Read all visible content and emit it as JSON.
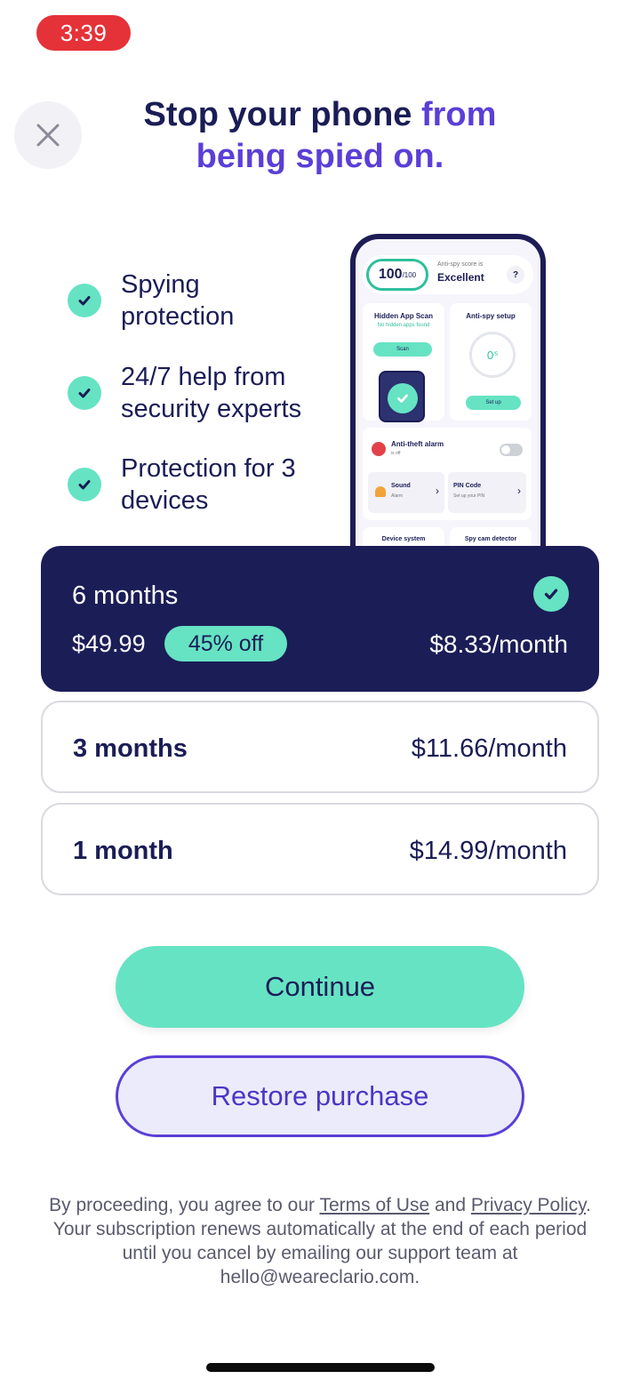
{
  "status_bar": {
    "time": "3:39"
  },
  "header": {
    "close_icon": "close-icon",
    "headline_part1": "Stop your phone ",
    "headline_accent1": "from",
    "headline_accent2": "being spied on."
  },
  "features": [
    {
      "label_line1": "Spying",
      "label_line2": "protection"
    },
    {
      "label_line1": "24/7 help from",
      "label_line2": "security experts"
    },
    {
      "label_line1": "Protection for 3",
      "label_line2": "devices"
    }
  ],
  "phone_mockup": {
    "score": "100",
    "score_max": "/100",
    "score_label": "Anti-spy score is",
    "score_value": "Excellent",
    "help": "?",
    "hidden_scan_title": "Hidden App Scan",
    "hidden_scan_sub": "No hidden apps found",
    "hidden_scan_button": "Scan",
    "antispy_title": "Anti-spy setup",
    "antispy_value": "0",
    "antispy_unit": "/5",
    "antispy_button": "Set up",
    "antitheft_title": "Anti-theft alarm",
    "antitheft_sub": "is off",
    "sound_title": "Sound",
    "sound_sub": "Alarm",
    "pin_title": "PIN Code",
    "pin_sub": "Set up your PIN",
    "device_system_title": "Device system",
    "spycam_title": "Spy cam detector"
  },
  "plans": {
    "selected": {
      "name": "6 months",
      "total": "$49.99",
      "badge": "45% off",
      "monthly": "$8.33/month"
    },
    "three_month": {
      "name": "3 months",
      "monthly": "$11.66/month"
    },
    "one_month": {
      "name": "1 month",
      "monthly": "$14.99/month"
    }
  },
  "actions": {
    "continue_label": "Continue",
    "restore_label": "Restore purchase"
  },
  "legal": {
    "prefix": "By proceeding, you agree to our ",
    "terms_link": "Terms of Use",
    "and": " and ",
    "privacy_link": "Privacy Policy",
    "suffix": ". Your subscription renews automatically at the end of each period until you cancel by emailing our support team at hello@weareclario.com."
  },
  "colors": {
    "navy": "#1b1d56",
    "accent_purple": "#5b3fd6",
    "mint": "#66e3c3",
    "status_red": "#e53238"
  }
}
